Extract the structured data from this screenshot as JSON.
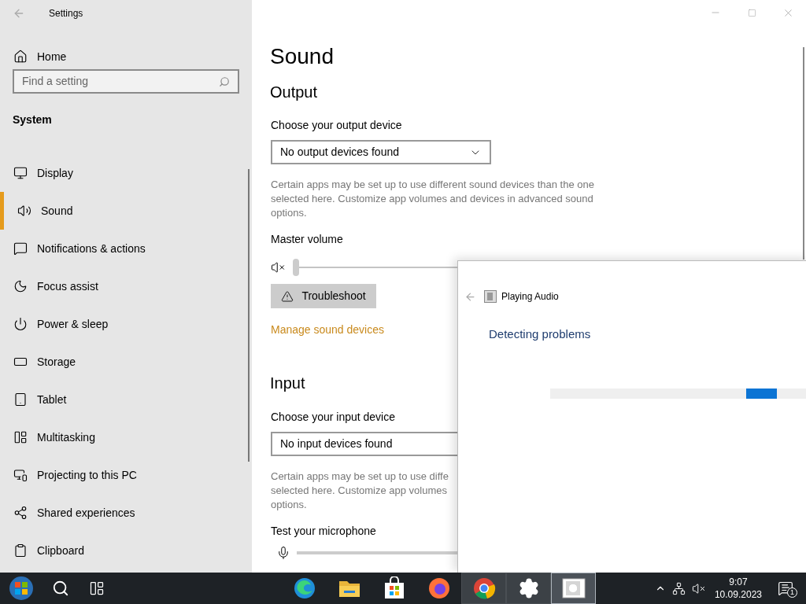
{
  "window": {
    "title": "Settings"
  },
  "sidebar": {
    "home": "Home",
    "search": {
      "placeholder": "Find a setting"
    },
    "section": "System",
    "items": [
      {
        "label": "Display",
        "selected": false
      },
      {
        "label": "Sound",
        "selected": true
      },
      {
        "label": "Notifications & actions",
        "selected": false
      },
      {
        "label": "Focus assist",
        "selected": false
      },
      {
        "label": "Power & sleep",
        "selected": false
      },
      {
        "label": "Storage",
        "selected": false
      },
      {
        "label": "Tablet",
        "selected": false
      },
      {
        "label": "Multitasking",
        "selected": false
      },
      {
        "label": "Projecting to this PC",
        "selected": false
      },
      {
        "label": "Shared experiences",
        "selected": false
      },
      {
        "label": "Clipboard",
        "selected": false
      }
    ]
  },
  "page": {
    "title": "Sound",
    "output": {
      "heading": "Output",
      "device_label": "Choose your output device",
      "device": "No output devices found",
      "note": [
        "Certain apps may be set up to use different sound devices than the one",
        "selected here. Customize app volumes and devices in advanced sound",
        "options."
      ],
      "volume_label": "Master volume",
      "volume": {
        "muted": true,
        "level": 0
      },
      "troubleshoot": "Troubleshoot",
      "manage_link": "Manage sound devices"
    },
    "input": {
      "heading": "Input",
      "device_label": "Choose your input device",
      "device": "No input devices found",
      "note": [
        "Certain apps may be set up to use diffe",
        "selected here. Customize app volumes",
        "options."
      ],
      "mic_label": "Test your microphone"
    }
  },
  "troubleshooter": {
    "title": "Playing Audio",
    "status": "Detecting problems",
    "progress": {
      "indeterminate": true
    }
  },
  "taskbar": {
    "apps": [
      {
        "running": false,
        "selected": false
      },
      {
        "running": false,
        "selected": false
      },
      {
        "running": false,
        "selected": false
      },
      {
        "running": false,
        "selected": false
      },
      {
        "running": true,
        "selected": false
      },
      {
        "running": true,
        "selected": false
      },
      {
        "running": true,
        "selected": true
      }
    ],
    "time": "9:07",
    "date": "10.09.2023",
    "notifications": "1"
  }
}
